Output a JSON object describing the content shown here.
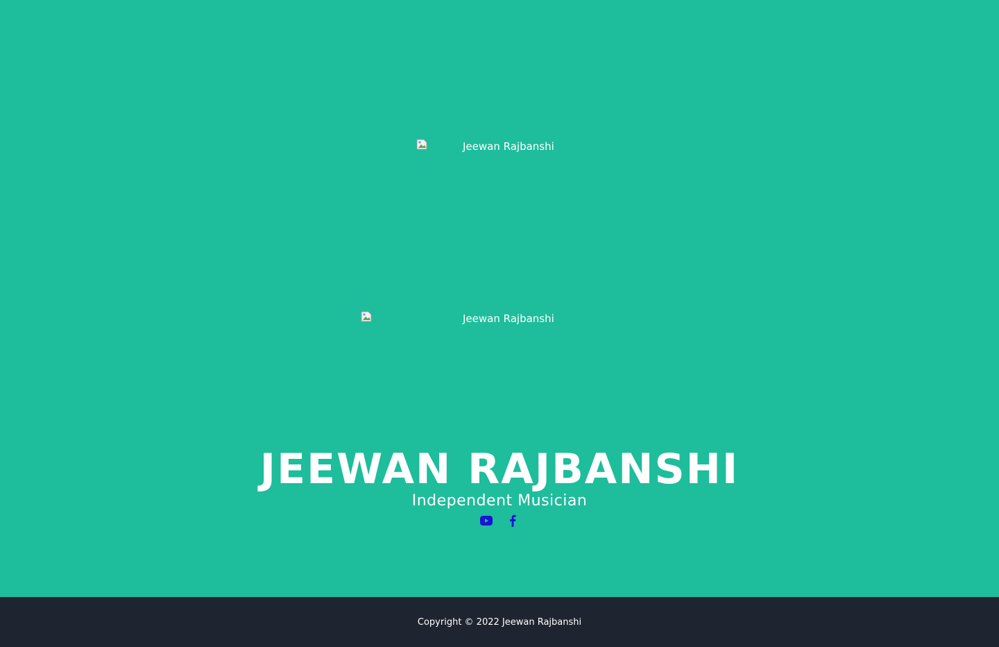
{
  "images": [
    {
      "alt": "Jeewan Rajbanshi"
    },
    {
      "alt": "Jeewan Rajbanshi"
    }
  ],
  "hero": {
    "title": "JEEWAN RAJBANSHI",
    "subtitle": "Independent Musician"
  },
  "social": [
    {
      "icon": "youtube-icon"
    },
    {
      "icon": "facebook-icon"
    }
  ],
  "footer": {
    "copyright": "Copyright © 2022 Jeewan Rajbanshi"
  },
  "colors": {
    "hero_bg": "#1ebd9c",
    "footer_bg": "#1e2430",
    "icon_color": "#1a12d6",
    "text": "#ffffff"
  }
}
